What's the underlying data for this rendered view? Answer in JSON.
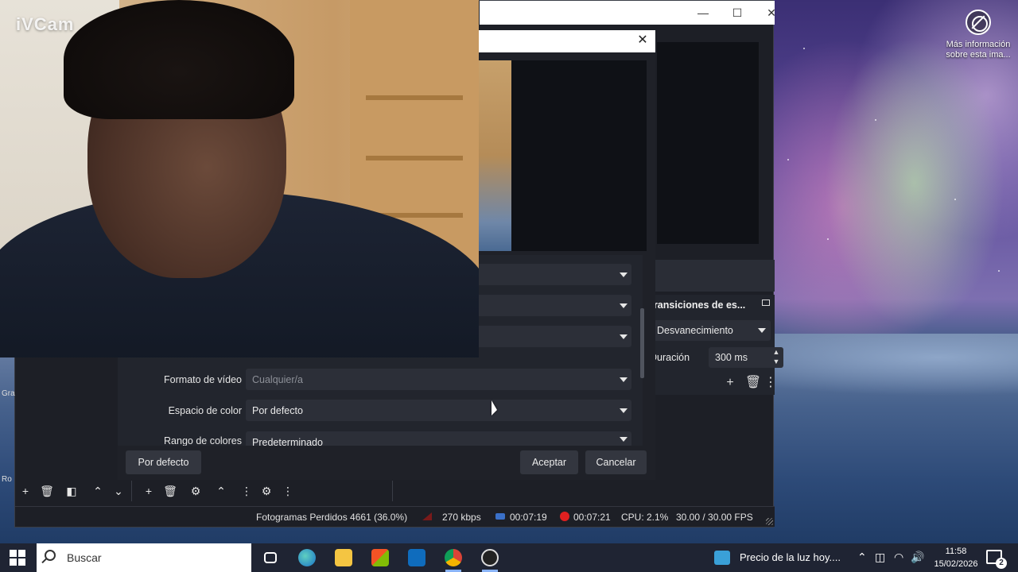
{
  "overlay": {
    "logo": "iVCam"
  },
  "desktop": {
    "spotlight_label": "Más información sobre esta ima..."
  },
  "obs": {
    "window_controls": {
      "minimize": "—",
      "maximize": "☐",
      "close": "✕"
    },
    "transitions": {
      "title": "Transiciones de es...",
      "selected": "Desvanecimiento",
      "duration_label": "Duración",
      "duration_value": "300 ms"
    },
    "status_bar": {
      "dropped_frames": "Fotogramas Perdidos 4661 (36.0%)",
      "bitrate": "270 kbps",
      "stream_time": "00:07:19",
      "rec_time": "00:07:21",
      "cpu": "CPU: 2.1%",
      "fps": "30.00 / 30.00 FPS"
    },
    "edge_labels": {
      "gra": "Gra",
      "ro": "Ro"
    }
  },
  "properties_dialog": {
    "close_glyph": "✕",
    "rows": [
      {
        "label": "",
        "value": ""
      },
      {
        "label": "",
        "value": ""
      },
      {
        "label": "",
        "value": ""
      },
      {
        "label": "Formato de vídeo",
        "value": "Cualquier/a"
      },
      {
        "label": "Espacio de color",
        "value": "Por defecto"
      },
      {
        "label": "Rango de colores",
        "value": "Predeterminado"
      }
    ],
    "buttons": {
      "defaults": "Por defecto",
      "ok": "Aceptar",
      "cancel": "Cancelar"
    }
  },
  "taskbar": {
    "search_placeholder": "Buscar",
    "news": "Precio de la luz hoy....",
    "clock_time": "11:58",
    "clock_date": "15/02/2026",
    "notifications": "2"
  },
  "colors": {
    "obs_bg": "#1d1f26",
    "panel_bg": "#22252d",
    "field_bg": "#2c2f38",
    "rec_red": "#e02020",
    "taskbar_bg": "#1f2433"
  }
}
